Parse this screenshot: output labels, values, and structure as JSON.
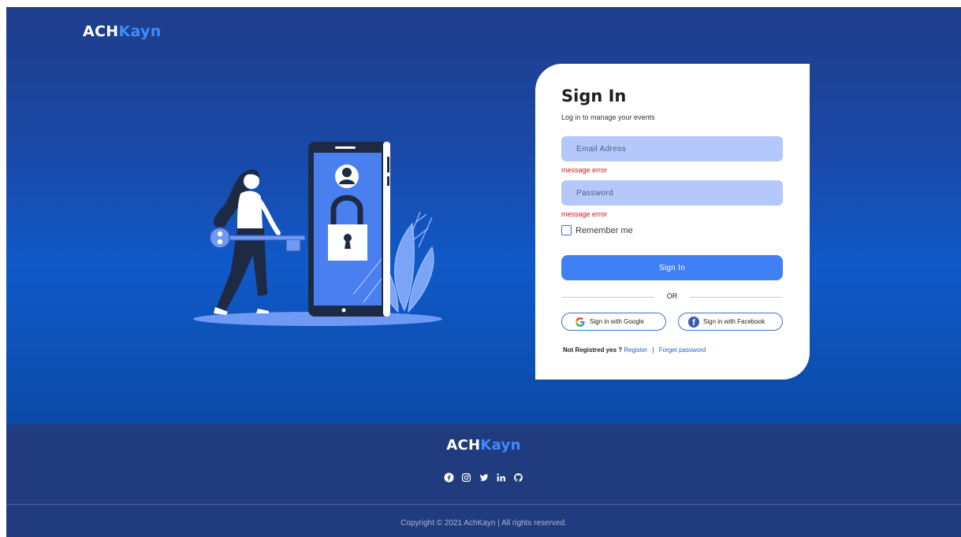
{
  "brand": {
    "part1": "ACH",
    "part2": "Kayn"
  },
  "login": {
    "title": "Sign In",
    "subtitle": "Log in to manage your events",
    "email_placeholder": "Email Adress",
    "password_placeholder": "Password",
    "email_error": "message error",
    "password_error": "message error",
    "remember_label": "Remember me",
    "signin_label": "Sign In",
    "or_label": "OR",
    "google_label": "Sign in with Google",
    "facebook_label": "Sign in with Facebook",
    "not_registered": "Not Registred yes ?",
    "register_link": "Register",
    "separator": "|",
    "forget_link": "Forget password"
  },
  "footer": {
    "socials": [
      "facebook-icon",
      "instagram-icon",
      "twitter-icon",
      "linkedin-icon",
      "github-icon"
    ],
    "copyright": "Copyright © 2021 AchKayn | All rights reserved."
  },
  "colors": {
    "hero_top": "#1f3d8a",
    "hero_mid": "#1059c9",
    "accent": "#3f80f4",
    "input_bg": "#b5c8fb",
    "error": "#d4141a",
    "footer_bg": "#213c7e",
    "brand_highlight": "#3d8bff"
  }
}
